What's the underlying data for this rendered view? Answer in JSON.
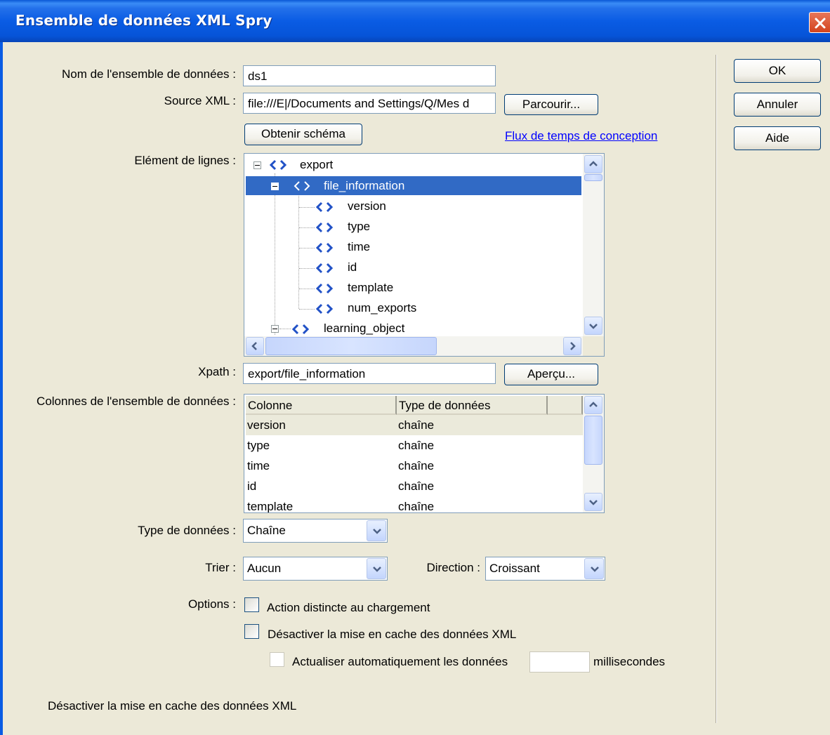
{
  "window": {
    "title": "Ensemble de données XML Spry"
  },
  "labels": {
    "dataset_name": "Nom de l'ensemble de données :",
    "xml_source": "Source XML :",
    "row_element": "Elément de lignes :",
    "xpath": "Xpath :",
    "dataset_columns": "Colonnes de l'ensemble de données :",
    "data_type": "Type de données :",
    "sort": "Trier :",
    "direction": "Direction :",
    "options": "Options :"
  },
  "fields": {
    "dataset_name": "ds1",
    "xml_source": "file:///E|/Documents and Settings/Q/Mes d",
    "xpath": "export/file_information"
  },
  "buttons": {
    "browse": "Parcourir...",
    "get_schema": "Obtenir schéma",
    "preview": "Aperçu...",
    "ok": "OK",
    "cancel": "Annuler",
    "help": "Aide"
  },
  "link": {
    "design_time_feed": "Flux de temps de conception"
  },
  "tree": {
    "root": "export",
    "selected": "file_information",
    "children": [
      "version",
      "type",
      "time",
      "id",
      "template",
      "num_exports"
    ],
    "next": "learning_object"
  },
  "columns_table": {
    "headers": [
      "Colonne",
      "Type de données"
    ],
    "rows": [
      [
        "version",
        "chaîne"
      ],
      [
        "type",
        "chaîne"
      ],
      [
        "time",
        "chaîne"
      ],
      [
        "id",
        "chaîne"
      ],
      [
        "template",
        "chaîne"
      ]
    ]
  },
  "selects": {
    "data_type": "Chaîne",
    "sort": "Aucun",
    "direction": "Croissant"
  },
  "options": {
    "distinct_on_load": "Action distincte au chargement",
    "disable_cache": "Désactiver la mise en cache des données XML",
    "auto_refresh": "Actualiser automatiquement les données",
    "auto_refresh_value": "",
    "milliseconds": "millisecondes"
  },
  "footer": {
    "hint": "Désactiver la mise en cache des données XML"
  },
  "colors": {
    "title_bar": "#0a5ce4",
    "selection": "#316ac5",
    "dialog_bg": "#ECE9D8",
    "link": "#0000ff"
  }
}
